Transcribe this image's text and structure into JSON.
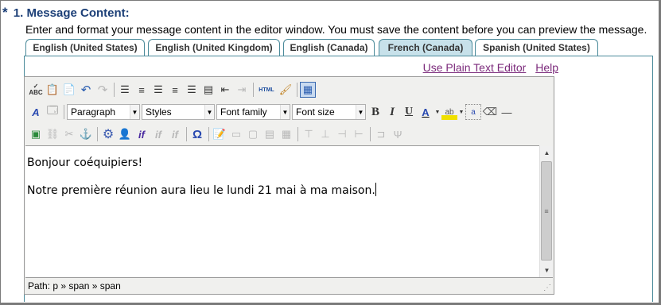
{
  "section": {
    "required_mark": "*",
    "title": "1. Message Content:",
    "instructions": "Enter and format your message content in the editor window. You must save the content before you can preview the message."
  },
  "tabs": [
    {
      "label": "English (United States)",
      "active": false
    },
    {
      "label": "English (United Kingdom)",
      "active": false
    },
    {
      "label": "English (Canada)",
      "active": false
    },
    {
      "label": "French (Canada)",
      "active": true
    },
    {
      "label": "Spanish (United States)",
      "active": false
    }
  ],
  "links": {
    "plain_text": "Use Plain Text Editor",
    "help": "Help"
  },
  "toolbar": {
    "paragraph": "Paragraph",
    "styles": "Styles",
    "font_family": "Font family",
    "font_size": "Font size",
    "html_label": "HTML"
  },
  "content": {
    "line1": "Bonjour coéquipiers!",
    "line2": "Notre première réunion aura lieu le lundi 21 mai à ma maison."
  },
  "status": {
    "path": "Path: p » span » span"
  },
  "colors": {
    "heading": "#1c3f77",
    "tab_border": "#4a8a9a",
    "active_tab": "#c7e1ea",
    "link": "#7b2a7b"
  }
}
